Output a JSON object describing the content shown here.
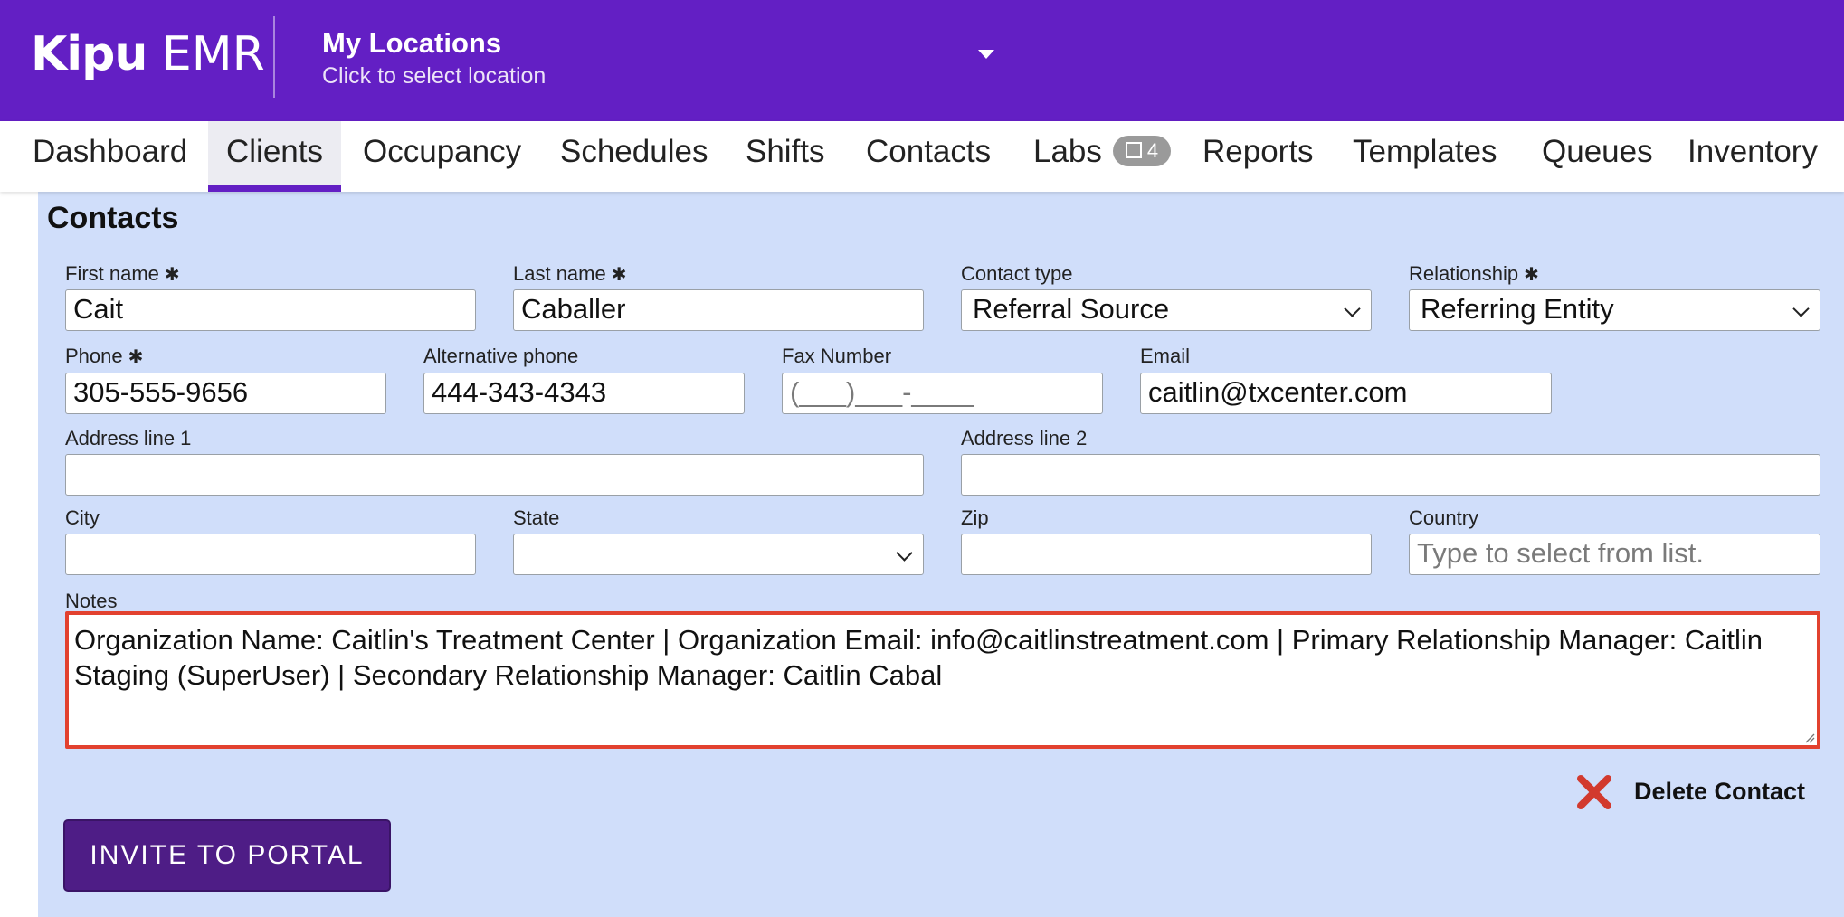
{
  "header": {
    "logo_brand": "Kipu",
    "logo_product": "EMR",
    "location_title": "My Locations",
    "location_subtitle": "Click to select location"
  },
  "nav": {
    "items": [
      {
        "label": "Dashboard"
      },
      {
        "label": "Clients",
        "active": true
      },
      {
        "label": "Occupancy"
      },
      {
        "label": "Schedules"
      },
      {
        "label": "Shifts"
      },
      {
        "label": "Contacts"
      },
      {
        "label": "Labs",
        "badge": "4"
      },
      {
        "label": "Reports"
      },
      {
        "label": "Templates"
      },
      {
        "label": "Queues"
      },
      {
        "label": "Inventory"
      }
    ]
  },
  "form": {
    "heading": "Contacts",
    "required_mark": "✱",
    "first_name": {
      "label": "First name",
      "value": "Cait"
    },
    "last_name": {
      "label": "Last name",
      "value": "Caballer"
    },
    "contact_type": {
      "label": "Contact type",
      "value": "Referral Source"
    },
    "relationship": {
      "label": "Relationship",
      "value": "Referring Entity"
    },
    "phone": {
      "label": "Phone",
      "value": "305-555-9656"
    },
    "alt_phone": {
      "label": "Alternative phone",
      "value": "444-343-4343"
    },
    "fax": {
      "label": "Fax Number",
      "placeholder": "(___)___-____"
    },
    "email": {
      "label": "Email",
      "value": "caitlin@txcenter.com"
    },
    "address1": {
      "label": "Address line 1",
      "value": ""
    },
    "address2": {
      "label": "Address line 2",
      "value": ""
    },
    "city": {
      "label": "City",
      "value": ""
    },
    "state": {
      "label": "State",
      "value": ""
    },
    "zip": {
      "label": "Zip",
      "value": ""
    },
    "country": {
      "label": "Country",
      "placeholder": "Type to select from list."
    },
    "notes": {
      "label": "Notes",
      "value": "Organization Name: Caitlin's Treatment Center | Organization Email: info@caitlinstreatment.com | Primary Relationship Manager: Caitlin Staging (SuperUser) | Secondary Relationship Manager: Caitlin Cabal"
    }
  },
  "actions": {
    "delete_label": "Delete Contact",
    "invite_label": "INVITE TO PORTAL"
  },
  "colors": {
    "brand_purple": "#631fc4",
    "panel_blue": "#d0defa",
    "invite_button": "#4e1d86",
    "notes_border": "#e2412f",
    "delete_red": "#d23a2e"
  },
  "icons": {
    "location_dropdown": "caret-down-icon",
    "labs_badge": "square-icon",
    "select_arrow": "chevron-down-icon",
    "delete": "x-icon"
  }
}
